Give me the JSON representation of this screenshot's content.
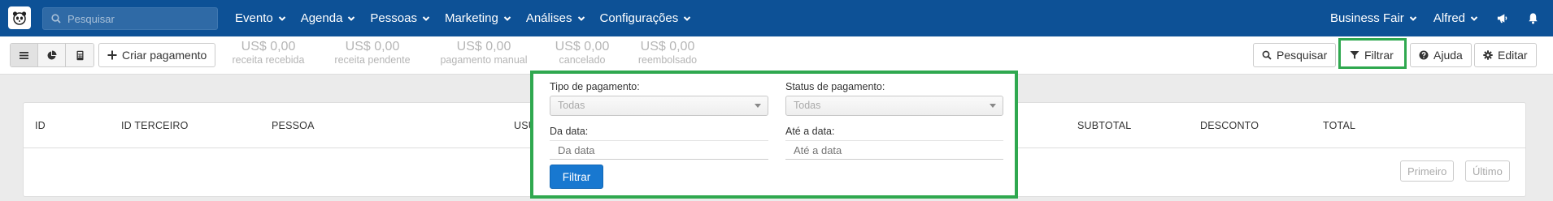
{
  "navbar": {
    "search_placeholder": "Pesquisar",
    "menu": [
      {
        "label": "Evento"
      },
      {
        "label": "Agenda"
      },
      {
        "label": "Pessoas"
      },
      {
        "label": "Marketing"
      },
      {
        "label": "Análises"
      },
      {
        "label": "Configurações"
      }
    ],
    "right": {
      "workspace": "Business Fair",
      "user": "Alfred",
      "icons": [
        "megaphone-icon",
        "bell-icon"
      ]
    },
    "colors": {
      "background": "#0d5196"
    }
  },
  "toolbar": {
    "view_buttons": [
      "list-icon",
      "pie-chart-icon",
      "calculator-icon"
    ],
    "create_label": "Criar pagamento",
    "stats": [
      {
        "value": "US$ 0,00",
        "label": "receita recebida"
      },
      {
        "value": "US$ 0,00",
        "label": "receita pendente"
      },
      {
        "value": "US$ 0,00",
        "label": "pagamento manual"
      },
      {
        "value": "US$ 0,00",
        "label": "cancelado"
      },
      {
        "value": "US$ 0,00",
        "label": "reembolsado"
      }
    ],
    "right_buttons": {
      "search": "Pesquisar",
      "filter": "Filtrar",
      "help": "Ajuda",
      "edit": "Editar"
    }
  },
  "table": {
    "columns": [
      "ID",
      "ID TERCEIRO",
      "PESSOA",
      "USU",
      "SUBTOTAL",
      "DESCONTO",
      "TOTAL"
    ],
    "pager": {
      "first": "Primeiro",
      "last": "Último"
    }
  },
  "filter_panel": {
    "payment_type_label": "Tipo de pagamento:",
    "payment_type_value": "Todas",
    "payment_status_label": "Status de pagamento:",
    "payment_status_value": "Todas",
    "from_date_label": "Da data:",
    "from_date_placeholder": "Da data",
    "to_date_label": "Até a data:",
    "to_date_placeholder": "Até a data",
    "submit_label": "Filtrar",
    "highlight_color": "#2fa84f"
  }
}
